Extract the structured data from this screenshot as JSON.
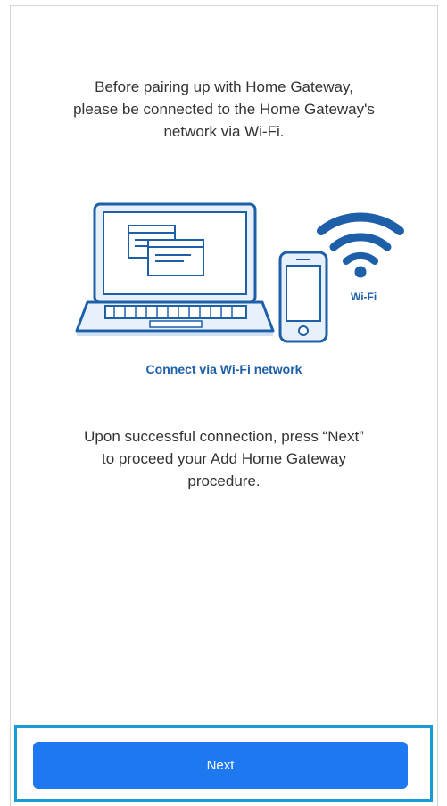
{
  "intro": {
    "line1": "Before pairing up with Home Gateway,",
    "line2": "please be connected to the Home Gateway's",
    "line3": "network via Wi-Fi."
  },
  "illustration": {
    "icons": [
      "laptop-icon",
      "phone-icon",
      "wifi-icon"
    ],
    "wifi_label": "Wi-Fi",
    "caption": "Connect via Wi-Fi network",
    "colors": {
      "outline": "#1d5fa8",
      "fill": "#e8f1fb",
      "accent": "#1e78f0"
    }
  },
  "outro": {
    "line1": "Upon successful connection, press “Next”",
    "line2": "to proceed your Add Home Gateway",
    "line3": "procedure."
  },
  "next_button": {
    "label": "Next",
    "color": "#1e78f0",
    "highlight_color": "#1a9ad6"
  }
}
